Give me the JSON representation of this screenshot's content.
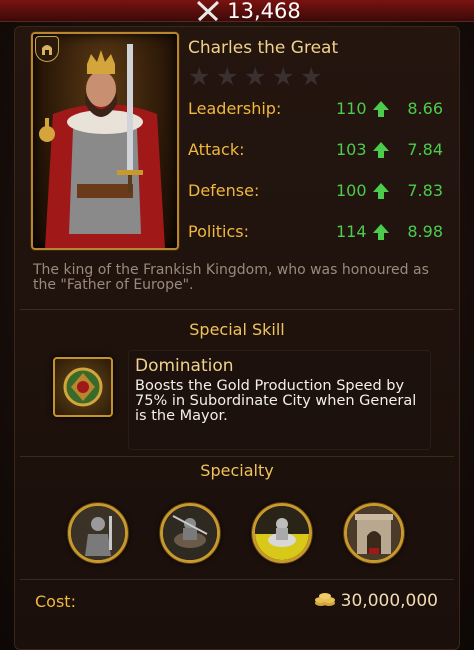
{
  "header": {
    "power": "13,468",
    "icon": "crossed-swords-icon"
  },
  "general": {
    "name": "Charles the Great",
    "stars_filled": 0,
    "stars_total": 5,
    "stats": [
      {
        "label": "Leadership:",
        "base": "110",
        "growth": "8.66"
      },
      {
        "label": "Attack:",
        "base": "103",
        "growth": "7.84"
      },
      {
        "label": "Defense:",
        "base": "100",
        "growth": "7.83"
      },
      {
        "label": "Politics:",
        "base": "114",
        "growth": "8.98"
      }
    ],
    "bio": "The king of the Frankish Kingdom, who was honoured as the \"Father of Europe\"."
  },
  "special_skill": {
    "title": "Special Skill",
    "name": "Domination",
    "description": "Boosts the Gold Production Speed by 75% in Subordinate City when General is the Mayor."
  },
  "specialty": {
    "title": "Specialty",
    "items": [
      "knight-icon",
      "cavalry-charge-icon",
      "armored-rider-icon",
      "arch-building-icon"
    ]
  },
  "cost": {
    "label": "Cost:",
    "value": "30,000,000",
    "icon": "gold-coins-icon"
  },
  "colors": {
    "stat_label": "#f0b83c",
    "stat_value": "#4ccb4c",
    "gold_border": "#c89a2e"
  }
}
